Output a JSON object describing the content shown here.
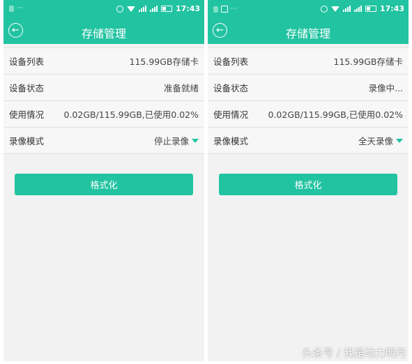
{
  "screens": [
    {
      "status_time": "17:43",
      "status_dots": "···",
      "title": "存储管理",
      "rows": [
        {
          "label": "设备列表",
          "value": "115.99GB存储卡"
        },
        {
          "label": "设备状态",
          "value": "准备就绪"
        },
        {
          "label": "使用情况",
          "value": "0.02GB/115.99GB,已使用0.02%"
        },
        {
          "label": "录像模式",
          "value": "停止录像"
        }
      ],
      "format_label": "格式化"
    },
    {
      "status_time": "17:43",
      "status_dots": "···",
      "title": "存储管理",
      "rows": [
        {
          "label": "设备列表",
          "value": "115.99GB存储卡"
        },
        {
          "label": "设备状态",
          "value": "录像中..."
        },
        {
          "label": "使用情况",
          "value": "0.02GB/115.99GB,已使用0.02%"
        },
        {
          "label": "录像模式",
          "value": "全天录像"
        }
      ],
      "format_label": "格式化"
    }
  ],
  "watermark": "头条号 / 我是动力明月",
  "colors": {
    "accent": "#22c3a1",
    "background": "#f2f2f2"
  },
  "icons": [
    "alarm-icon",
    "wifi-icon",
    "signal-icon",
    "battery-icon",
    "back-icon",
    "dropdown-arrow-icon"
  ]
}
